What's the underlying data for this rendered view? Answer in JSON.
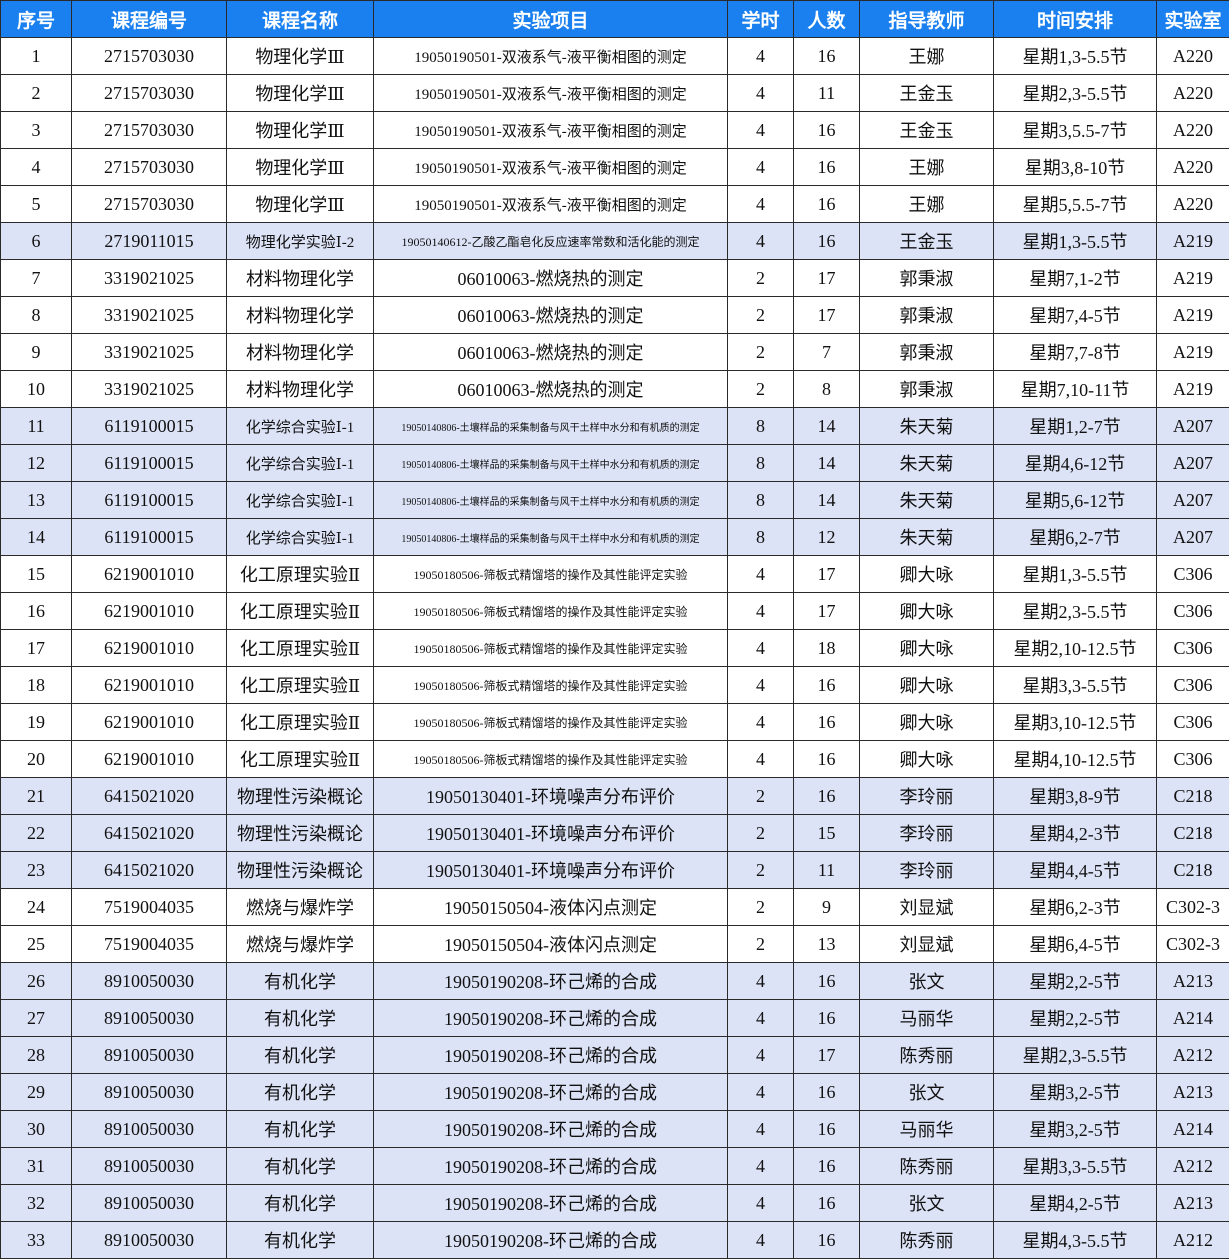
{
  "table": {
    "headers": [
      "序号",
      "课程编号",
      "课程名称",
      "实验项目",
      "学时",
      "人数",
      "指导教师",
      "时间安排",
      "实验室"
    ],
    "colors": {
      "header_bg": "#1a80f0",
      "header_text": "#ffffff",
      "shaded_row": "#dde3f6",
      "plain_row": "#ffffff"
    },
    "rows": [
      {
        "no": "1",
        "code": "2715703030",
        "course": "物理化学Ⅲ",
        "project": "19050190501-双液系气-液平衡相图的测定",
        "hours": "4",
        "people": "16",
        "teacher": "王娜",
        "time": "星期1,3-5.5节",
        "room": "A220",
        "shaded": false
      },
      {
        "no": "2",
        "code": "2715703030",
        "course": "物理化学Ⅲ",
        "project": "19050190501-双液系气-液平衡相图的测定",
        "hours": "4",
        "people": "11",
        "teacher": "王金玉",
        "time": "星期2,3-5.5节",
        "room": "A220",
        "shaded": false
      },
      {
        "no": "3",
        "code": "2715703030",
        "course": "物理化学Ⅲ",
        "project": "19050190501-双液系气-液平衡相图的测定",
        "hours": "4",
        "people": "16",
        "teacher": "王金玉",
        "time": "星期3,5.5-7节",
        "room": "A220",
        "shaded": false
      },
      {
        "no": "4",
        "code": "2715703030",
        "course": "物理化学Ⅲ",
        "project": "19050190501-双液系气-液平衡相图的测定",
        "hours": "4",
        "people": "16",
        "teacher": "王娜",
        "time": "星期3,8-10节",
        "room": "A220",
        "shaded": false
      },
      {
        "no": "5",
        "code": "2715703030",
        "course": "物理化学Ⅲ",
        "project": "19050190501-双液系气-液平衡相图的测定",
        "hours": "4",
        "people": "16",
        "teacher": "王娜",
        "time": "星期5,5.5-7节",
        "room": "A220",
        "shaded": false
      },
      {
        "no": "6",
        "code": "2719011015",
        "course": "物理化学实验Ⅰ-2",
        "project": "19050140612-乙酸乙酯皂化反应速率常数和活化能的测定",
        "hours": "4",
        "people": "16",
        "teacher": "王金玉",
        "time": "星期1,3-5.5节",
        "room": "A219",
        "shaded": true
      },
      {
        "no": "7",
        "code": "3319021025",
        "course": "材料物理化学",
        "project": "06010063-燃烧热的测定",
        "hours": "2",
        "people": "17",
        "teacher": "郭秉淑",
        "time": "星期7,1-2节",
        "room": "A219",
        "shaded": false
      },
      {
        "no": "8",
        "code": "3319021025",
        "course": "材料物理化学",
        "project": "06010063-燃烧热的测定",
        "hours": "2",
        "people": "17",
        "teacher": "郭秉淑",
        "time": "星期7,4-5节",
        "room": "A219",
        "shaded": false
      },
      {
        "no": "9",
        "code": "3319021025",
        "course": "材料物理化学",
        "project": "06010063-燃烧热的测定",
        "hours": "2",
        "people": "7",
        "teacher": "郭秉淑",
        "time": "星期7,7-8节",
        "room": "A219",
        "shaded": false
      },
      {
        "no": "10",
        "code": "3319021025",
        "course": "材料物理化学",
        "project": "06010063-燃烧热的测定",
        "hours": "2",
        "people": "8",
        "teacher": "郭秉淑",
        "time": "星期7,10-11节",
        "room": "A219",
        "shaded": false
      },
      {
        "no": "11",
        "code": "6119100015",
        "course": "化学综合实验Ⅰ-1",
        "project": "19050140806-土壤样品的采集制备与风干土样中水分和有机质的测定",
        "hours": "8",
        "people": "14",
        "teacher": "朱天菊",
        "time": "星期1,2-7节",
        "room": "A207",
        "shaded": true
      },
      {
        "no": "12",
        "code": "6119100015",
        "course": "化学综合实验Ⅰ-1",
        "project": "19050140806-土壤样品的采集制备与风干土样中水分和有机质的测定",
        "hours": "8",
        "people": "14",
        "teacher": "朱天菊",
        "time": "星期4,6-12节",
        "room": "A207",
        "shaded": true
      },
      {
        "no": "13",
        "code": "6119100015",
        "course": "化学综合实验Ⅰ-1",
        "project": "19050140806-土壤样品的采集制备与风干土样中水分和有机质的测定",
        "hours": "8",
        "people": "14",
        "teacher": "朱天菊",
        "time": "星期5,6-12节",
        "room": "A207",
        "shaded": true
      },
      {
        "no": "14",
        "code": "6119100015",
        "course": "化学综合实验Ⅰ-1",
        "project": "19050140806-土壤样品的采集制备与风干土样中水分和有机质的测定",
        "hours": "8",
        "people": "12",
        "teacher": "朱天菊",
        "time": "星期6,2-7节",
        "room": "A207",
        "shaded": true
      },
      {
        "no": "15",
        "code": "6219001010",
        "course": "化工原理实验Ⅱ",
        "project": "19050180506-筛板式精馏塔的操作及其性能评定实验",
        "hours": "4",
        "people": "17",
        "teacher": "卿大咏",
        "time": "星期1,3-5.5节",
        "room": "C306",
        "shaded": false
      },
      {
        "no": "16",
        "code": "6219001010",
        "course": "化工原理实验Ⅱ",
        "project": "19050180506-筛板式精馏塔的操作及其性能评定实验",
        "hours": "4",
        "people": "17",
        "teacher": "卿大咏",
        "time": "星期2,3-5.5节",
        "room": "C306",
        "shaded": false
      },
      {
        "no": "17",
        "code": "6219001010",
        "course": "化工原理实验Ⅱ",
        "project": "19050180506-筛板式精馏塔的操作及其性能评定实验",
        "hours": "4",
        "people": "18",
        "teacher": "卿大咏",
        "time": "星期2,10-12.5节",
        "room": "C306",
        "shaded": false
      },
      {
        "no": "18",
        "code": "6219001010",
        "course": "化工原理实验Ⅱ",
        "project": "19050180506-筛板式精馏塔的操作及其性能评定实验",
        "hours": "4",
        "people": "16",
        "teacher": "卿大咏",
        "time": "星期3,3-5.5节",
        "room": "C306",
        "shaded": false
      },
      {
        "no": "19",
        "code": "6219001010",
        "course": "化工原理实验Ⅱ",
        "project": "19050180506-筛板式精馏塔的操作及其性能评定实验",
        "hours": "4",
        "people": "16",
        "teacher": "卿大咏",
        "time": "星期3,10-12.5节",
        "room": "C306",
        "shaded": false
      },
      {
        "no": "20",
        "code": "6219001010",
        "course": "化工原理实验Ⅱ",
        "project": "19050180506-筛板式精馏塔的操作及其性能评定实验",
        "hours": "4",
        "people": "16",
        "teacher": "卿大咏",
        "time": "星期4,10-12.5节",
        "room": "C306",
        "shaded": false
      },
      {
        "no": "21",
        "code": "6415021020",
        "course": "物理性污染概论",
        "project": "19050130401-环境噪声分布评价",
        "hours": "2",
        "people": "16",
        "teacher": "李玲丽",
        "time": "星期3,8-9节",
        "room": "C218",
        "shaded": true
      },
      {
        "no": "22",
        "code": "6415021020",
        "course": "物理性污染概论",
        "project": "19050130401-环境噪声分布评价",
        "hours": "2",
        "people": "15",
        "teacher": "李玲丽",
        "time": "星期4,2-3节",
        "room": "C218",
        "shaded": true
      },
      {
        "no": "23",
        "code": "6415021020",
        "course": "物理性污染概论",
        "project": "19050130401-环境噪声分布评价",
        "hours": "2",
        "people": "11",
        "teacher": "李玲丽",
        "time": "星期4,4-5节",
        "room": "C218",
        "shaded": true
      },
      {
        "no": "24",
        "code": "7519004035",
        "course": "燃烧与爆炸学",
        "project": "19050150504-液体闪点测定",
        "hours": "2",
        "people": "9",
        "teacher": "刘显斌",
        "time": "星期6,2-3节",
        "room": "C302-3",
        "shaded": false
      },
      {
        "no": "25",
        "code": "7519004035",
        "course": "燃烧与爆炸学",
        "project": "19050150504-液体闪点测定",
        "hours": "2",
        "people": "13",
        "teacher": "刘显斌",
        "time": "星期6,4-5节",
        "room": "C302-3",
        "shaded": false
      },
      {
        "no": "26",
        "code": "8910050030",
        "course": "有机化学",
        "project": "19050190208-环己烯的合成",
        "hours": "4",
        "people": "16",
        "teacher": "张文",
        "time": "星期2,2-5节",
        "room": "A213",
        "shaded": true
      },
      {
        "no": "27",
        "code": "8910050030",
        "course": "有机化学",
        "project": "19050190208-环己烯的合成",
        "hours": "4",
        "people": "16",
        "teacher": "马丽华",
        "time": "星期2,2-5节",
        "room": "A214",
        "shaded": true
      },
      {
        "no": "28",
        "code": "8910050030",
        "course": "有机化学",
        "project": "19050190208-环己烯的合成",
        "hours": "4",
        "people": "17",
        "teacher": "陈秀丽",
        "time": "星期2,3-5.5节",
        "room": "A212",
        "shaded": true
      },
      {
        "no": "29",
        "code": "8910050030",
        "course": "有机化学",
        "project": "19050190208-环己烯的合成",
        "hours": "4",
        "people": "16",
        "teacher": "张文",
        "time": "星期3,2-5节",
        "room": "A213",
        "shaded": true
      },
      {
        "no": "30",
        "code": "8910050030",
        "course": "有机化学",
        "project": "19050190208-环己烯的合成",
        "hours": "4",
        "people": "16",
        "teacher": "马丽华",
        "time": "星期3,2-5节",
        "room": "A214",
        "shaded": true
      },
      {
        "no": "31",
        "code": "8910050030",
        "course": "有机化学",
        "project": "19050190208-环己烯的合成",
        "hours": "4",
        "people": "16",
        "teacher": "陈秀丽",
        "time": "星期3,3-5.5节",
        "room": "A212",
        "shaded": true
      },
      {
        "no": "32",
        "code": "8910050030",
        "course": "有机化学",
        "project": "19050190208-环己烯的合成",
        "hours": "4",
        "people": "16",
        "teacher": "张文",
        "time": "星期4,2-5节",
        "room": "A213",
        "shaded": true
      },
      {
        "no": "33",
        "code": "8910050030",
        "course": "有机化学",
        "project": "19050190208-环己烯的合成",
        "hours": "4",
        "people": "16",
        "teacher": "陈秀丽",
        "time": "星期4,3-5.5节",
        "room": "A212",
        "shaded": true
      }
    ]
  }
}
